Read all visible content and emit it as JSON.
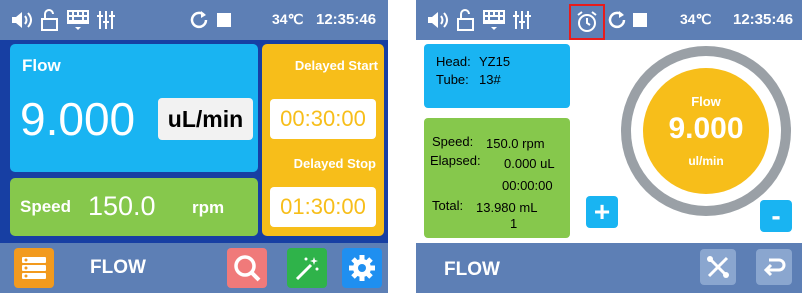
{
  "screen1": {
    "status": {
      "temperature": "34℃",
      "time": "12:35:46"
    },
    "flow": {
      "label": "Flow",
      "value": "9.000",
      "unit": "uL/min"
    },
    "speed": {
      "label": "Speed",
      "value": "150.0",
      "unit": "rpm"
    },
    "delay": {
      "start_label": "Delayed Start",
      "start_time": "00:30:00",
      "stop_label": "Delayed Stop",
      "stop_time": "01:30:00"
    },
    "bottom": {
      "mode_label": "FLOW"
    }
  },
  "screen2": {
    "status": {
      "temperature": "34℃",
      "time": "12:35:46"
    },
    "info": {
      "head_label": "Head:",
      "head_value": "YZ15",
      "tube_label": "Tube:",
      "tube_value": "13#"
    },
    "stats": {
      "speed_label": "Speed:",
      "speed_value": "150.0 rpm",
      "elapsed_label": "Elapsed:",
      "elapsed_value": "0.000 uL",
      "elapsed_time": "00:00:00",
      "total_label": "Total:",
      "total_value": "13.980 mL",
      "total_count": "1"
    },
    "dial": {
      "label": "Flow",
      "value": "9.000",
      "unit": "ul/min"
    },
    "buttons": {
      "plus": "+",
      "minus": "-"
    },
    "bottom": {
      "mode_label": "FLOW"
    }
  },
  "colors": {
    "status_bar": "#5d7fb5",
    "screen1_bg": "#173fa3",
    "flow_blue": "#19b4f2",
    "speed_green": "#86c84c",
    "accent_orange": "#f7be1a",
    "alarm_highlight": "#e81c1c",
    "menu_orange": "#f29a1e",
    "search_red": "#f07a7a",
    "wizard_green": "#2fb34a",
    "settings_blue": "#1f8ff0"
  },
  "icons": [
    "speaker-icon",
    "unlock-icon",
    "keyboard-icon",
    "equalizer-icon",
    "refresh-icon",
    "stop-icon",
    "alarm-clock-icon",
    "menu-list-icon",
    "search-icon",
    "magic-wand-icon",
    "gear-icon",
    "tools-icon",
    "return-icon"
  ]
}
